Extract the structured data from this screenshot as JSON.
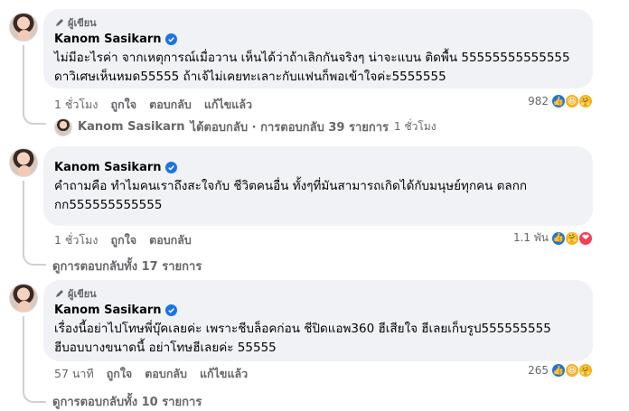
{
  "comments": [
    {
      "badge": "ผู้เขียน",
      "name": "Kanom Sasikarn",
      "text": "ไม่มีอะไรค่า จากเหตุการณ์เมื่อวาน เห็นได้ว่าถ้าเลิกกันจริงๆ น่าจะแบน ติดพื้น 55555555555555\nดาวิเศษเห็นหมด55555 ถ้าเจ้ไม่เคยทะเลาะกับแฟนก็พอเข้าใจค่ะ5555555",
      "time": "1 ชั่วโมง",
      "like": "ถูกใจ",
      "reply": "ตอบกลับ",
      "edited": "แก้ไขแล้ว",
      "reaction_count": "982",
      "reactions": [
        "like-icon",
        "haha-icon",
        "care-icon"
      ]
    },
    {
      "name": "Kanom Sasikarn",
      "text": "คำถามคือ ทำไมคนเราถึงสะใจกับ ชีวิตคนอื่น ทั้งๆที่มันสามารถเกิดได้กับมนุษย์ทุกคน ตลกก\nกก555555555555",
      "time": "1 ชั่วโมง",
      "like": "ถูกใจ",
      "reply": "ตอบกลับ",
      "reaction_count": "1.1 พัน",
      "reactions": [
        "like-icon",
        "care-icon",
        "love-icon"
      ]
    },
    {
      "badge": "ผู้เขียน",
      "name": "Kanom Sasikarn",
      "text": "เรื่องนี้อย่าไปโทษพี่บุ๊คเลยค่ะ เพราะชีบล็อคก่อน ชีปิดแอพ360 ฮีเสียใจ ฮีเลยเก็บรูป555555555\nฮีบอบบางขนาดนี้ อย่าโทษฮีเลยค่ะ 55555",
      "time": "57 นาที",
      "like": "ถูกใจ",
      "reply": "ตอบกลับ",
      "edited": "แก้ไขแล้ว",
      "reaction_count": "265",
      "reactions": [
        "like-icon",
        "haha-icon",
        "care-icon"
      ]
    }
  ],
  "reply_preview": {
    "name": "Kanom Sasikarn",
    "summary": "ได้ตอบกลับ · การตอบกลับ 39 รายการ",
    "time": "1 ชั่วโมง"
  },
  "view_replies_2": "ดูการตอบกลับทั้ง 17 รายการ",
  "view_replies_3": "ดูการตอบกลับทั้ง 10 รายการ",
  "colors": {
    "verified": "#1b74e4",
    "bubble": "#f0f2f5",
    "muted": "#65676b"
  }
}
